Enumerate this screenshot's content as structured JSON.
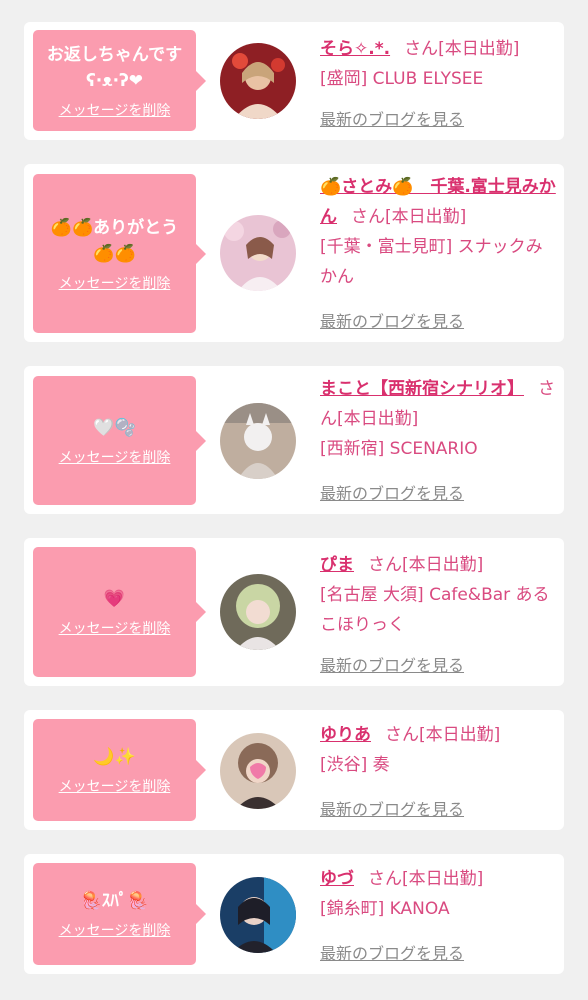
{
  "delete_label": "メッセージを削除",
  "san_label": "さん",
  "status_label": "[本日出勤]",
  "blog_label": "最新のブログを見る",
  "cards": [
    {
      "message": "お返しちゃんです\nʕ·ᴥ·ʔ❤",
      "name": "そら✧.*.",
      "area": "[盛岡]",
      "shop": "CLUB ELYSEE",
      "avatar_color": "#b33a3a"
    },
    {
      "message": "🍊🍊ありがとう\n🍊🍊",
      "name": "🍊さとみ🍊　千葉.富士見みかん",
      "area": "[千葉・富士見町]",
      "shop": "スナックみかん",
      "avatar_color": "#e6b8c8"
    },
    {
      "message": "🤍🫧",
      "name": "まこと【西新宿シナリオ】",
      "area": "[西新宿]",
      "shop": "SCENARIO",
      "avatar_color": "#c9b8b0"
    },
    {
      "message": "💗",
      "name": "ぴま",
      "area": "[名古屋 大須]",
      "shop": "Cafe&Bar あるこほりっく",
      "avatar_color": "#a8b88a"
    },
    {
      "message": "🌙✨",
      "name": "ゆりあ",
      "area": "[渋谷]",
      "shop": "奏",
      "avatar_color": "#c8a890"
    },
    {
      "message": "🪼ｽﾊﾟ🪼",
      "name": "ゆづ",
      "area": "[錦糸町]",
      "shop": "KANOA",
      "avatar_color": "#2a5a8a"
    }
  ]
}
